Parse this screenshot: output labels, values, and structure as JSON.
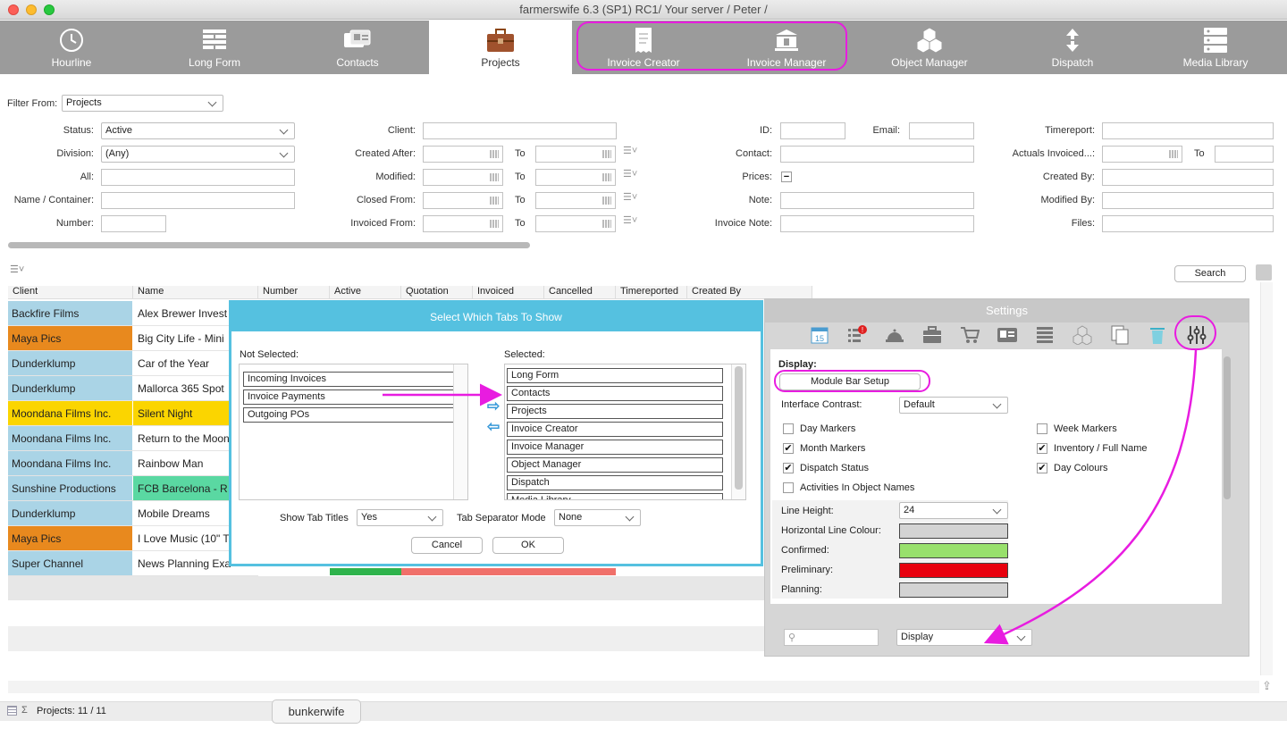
{
  "window": {
    "title": "farmerswife 6.3 (SP1)  RC1/ Your server / Peter /"
  },
  "tabs": [
    {
      "label": "Hourline",
      "icon": "clock-icon"
    },
    {
      "label": "Long Form",
      "icon": "long-form-icon"
    },
    {
      "label": "Contacts",
      "icon": "contacts-icon"
    },
    {
      "label": "Projects",
      "icon": "briefcase-icon",
      "active": true
    },
    {
      "label": "Invoice Creator",
      "icon": "receipt-icon"
    },
    {
      "label": "Invoice Manager",
      "icon": "bank-icon"
    },
    {
      "label": "Object Manager",
      "icon": "cubes-icon"
    },
    {
      "label": "Dispatch",
      "icon": "dispatch-arrows-icon"
    },
    {
      "label": "Media Library",
      "icon": "server-icon"
    }
  ],
  "filter": {
    "from_label": "Filter From:",
    "from_value": "Projects",
    "status_label": "Status:",
    "status_value": "Active",
    "division_label": "Division:",
    "division_value": "(Any)",
    "all_label": "All:",
    "name_label": "Name / Container:",
    "number_label": "Number:",
    "client_label": "Client:",
    "created_after_label": "Created After:",
    "modified_label": "Modified:",
    "closed_from_label": "Closed From:",
    "invoiced_from_label": "Invoiced From:",
    "to_label": "To",
    "id_label": "ID:",
    "email_label": "Email:",
    "contact_label": "Contact:",
    "prices_label": "Prices:",
    "prices_value": "−",
    "note_label": "Note:",
    "invoice_note_label": "Invoice Note:",
    "timereport_label": "Timereport:",
    "actuals_label": "Actuals Invoiced...:",
    "created_by_label": "Created By:",
    "modified_by_label": "Modified By:",
    "files_label": "Files:",
    "search_button": "Search"
  },
  "table": {
    "columns": [
      "Client",
      "Name",
      "Number",
      "Active",
      "Quotation",
      "Invoiced",
      "Cancelled",
      "Timereported",
      "Created By"
    ],
    "rows": [
      {
        "client": "Backfire Films",
        "name": "Alex Brewer Invest",
        "client_color": "#aad4e6",
        "name_color": "#ffffff"
      },
      {
        "client": "Maya Pics",
        "name": "Big City Life - Mini",
        "client_color": "#e8891e",
        "name_color": "#ffffff"
      },
      {
        "client": "Dunderklump",
        "name": "Car of the Year",
        "client_color": "#aad4e6",
        "name_color": "#ffffff"
      },
      {
        "client": "Dunderklump",
        "name": "Mallorca 365 Spot",
        "client_color": "#aad4e6",
        "name_color": "#ffffff"
      },
      {
        "client": "Moondana Films Inc.",
        "name": "Silent Night",
        "client_color": "#fbd500",
        "name_color": "#fbd500"
      },
      {
        "client": "Moondana Films Inc.",
        "name": "Return to the Moon",
        "client_color": "#aad4e6",
        "name_color": "#ffffff"
      },
      {
        "client": "Moondana Films Inc.",
        "name": "Rainbow Man",
        "client_color": "#aad4e6",
        "name_color": "#ffffff"
      },
      {
        "client": "Sunshine Productions",
        "name": "FCB Barcelona - R",
        "client_color": "#aad4e6",
        "name_color": "#5ad8a2"
      },
      {
        "client": "Dunderklump",
        "name": "Mobile Dreams",
        "client_color": "#aad4e6",
        "name_color": "#ffffff"
      },
      {
        "client": "Maya Pics",
        "name": "I Love Music (10\" T",
        "client_color": "#e8891e",
        "name_color": "#ffffff"
      },
      {
        "client": "Super Channel",
        "name": "News Planning Exa",
        "client_color": "#aad4e6",
        "name_color": "#ffffff"
      }
    ]
  },
  "status_bar": {
    "count": "Projects: 11 / 11",
    "tooltip": "bunkerwife",
    "sigma": "Σ"
  },
  "dialog": {
    "title": "Select Which Tabs To Show",
    "not_selected_label": "Not Selected:",
    "not_selected": [
      "Incoming Invoices",
      "Invoice Payments",
      "Outgoing POs"
    ],
    "selected_label": "Selected:",
    "selected": [
      "Long Form",
      "Contacts",
      "Projects",
      "Invoice Creator",
      "Invoice Manager",
      "Object Manager",
      "Dispatch",
      "Media Library"
    ],
    "show_tab_titles_label": "Show Tab Titles",
    "show_tab_titles_value": "Yes",
    "separator_label": "Tab Separator Mode",
    "separator_value": "None",
    "cancel": "Cancel",
    "ok": "OK"
  },
  "settings": {
    "title": "Settings",
    "icons": [
      "calendar-icon",
      "alert-list-icon",
      "bell-icon",
      "briefcase-icon",
      "cart-icon",
      "id-card-icon",
      "list-icon",
      "cubes-icon",
      "copy-icon",
      "trash-icon",
      "sliders-icon"
    ],
    "calendar_day": "15",
    "display_label": "Display:",
    "module_bar_setup": "Module Bar Setup",
    "contrast_label": "Interface Contrast:",
    "contrast_value": "Default",
    "checks": [
      {
        "label": "Day Markers",
        "checked": false
      },
      {
        "label": "Month Markers",
        "checked": true
      },
      {
        "label": "Dispatch Status",
        "checked": true
      },
      {
        "label": "Activities In Object Names",
        "checked": false
      },
      {
        "label": "Week Markers",
        "checked": false
      },
      {
        "label": "Inventory / Full Name",
        "checked": true
      },
      {
        "label": "Day Colours",
        "checked": true
      }
    ],
    "line_height_label": "Line Height:",
    "line_height_value": "24",
    "colours": [
      {
        "label": "Horizontal Line Colour:",
        "color": "#d3d3d3"
      },
      {
        "label": "Confirmed:",
        "color": "#98e06c"
      },
      {
        "label": "Preliminary:",
        "color": "#e8000e"
      },
      {
        "label": "Planning:",
        "color": "#d3d3d3"
      }
    ],
    "section_value": "Display",
    "check_mark": "✔"
  },
  "annotation_color": "#e81ce0"
}
